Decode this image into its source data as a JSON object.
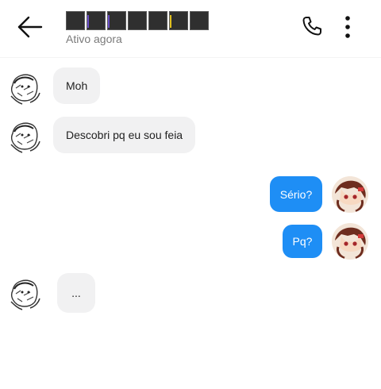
{
  "header": {
    "back_icon": "arrow-left-icon",
    "status": "Ativo agora",
    "call_icon": "phone-icon",
    "more_icon": "more-vertical-icon",
    "title_obscured_blocks": 7
  },
  "messages": [
    {
      "from": "contact",
      "text": "Moh"
    },
    {
      "from": "contact",
      "text": "Descobri pq eu sou feia"
    },
    {
      "from": "me",
      "text": "Sério?"
    },
    {
      "from": "me",
      "text": "Pq?"
    },
    {
      "from": "contact",
      "text": "..."
    }
  ],
  "colors": {
    "outgoing_bubble": "#1e8ef5",
    "incoming_bubble": "#f1f1f2",
    "status_text": "#7a7a7a"
  }
}
